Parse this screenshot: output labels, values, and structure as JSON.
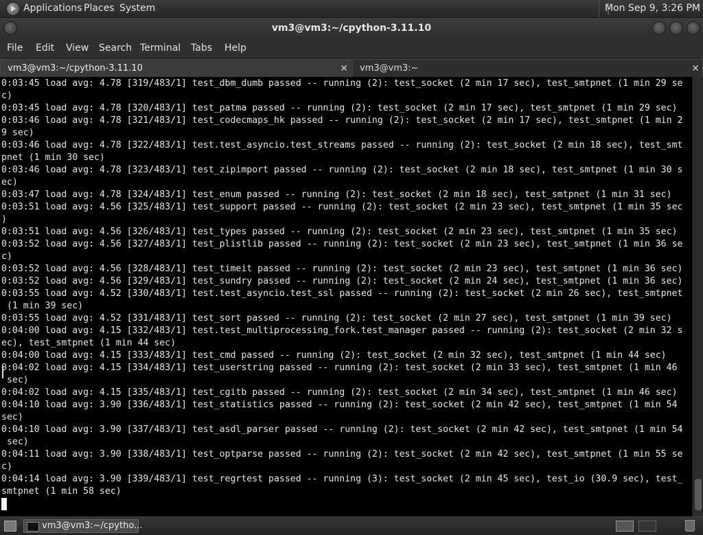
{
  "top_panel": {
    "menus": [
      "Applications",
      "Places",
      "System"
    ],
    "clock": "Mon Sep  9,  3:26 PM"
  },
  "window": {
    "title": "vm3@vm3:~/cpython-3.11.10"
  },
  "menubar": [
    "File",
    "Edit",
    "View",
    "Search",
    "Terminal",
    "Tabs",
    "Help"
  ],
  "tabs": [
    {
      "label": "vm3@vm3:~/cpython-3.11.10",
      "active": true
    },
    {
      "label": "vm3@vm3:~",
      "active": false
    }
  ],
  "terminal_lines": [
    "0:03:45 load avg: 4.78 [319/483/1] test_dbm_dumb passed -- running (2): test_socket (2 min 17 sec), test_smtpnet (1 min 29 se",
    "c)",
    "0:03:45 load avg: 4.78 [320/483/1] test_patma passed -- running (2): test_socket (2 min 17 sec), test_smtpnet (1 min 29 sec)",
    "0:03:46 load avg: 4.78 [321/483/1] test_codecmaps_hk passed -- running (2): test_socket (2 min 17 sec), test_smtpnet (1 min 2",
    "9 sec)",
    "0:03:46 load avg: 4.78 [322/483/1] test.test_asyncio.test_streams passed -- running (2): test_socket (2 min 18 sec), test_smt",
    "pnet (1 min 30 sec)",
    "0:03:46 load avg: 4.78 [323/483/1] test_zipimport passed -- running (2): test_socket (2 min 18 sec), test_smtpnet (1 min 30 s",
    "ec)",
    "0:03:47 load avg: 4.78 [324/483/1] test_enum passed -- running (2): test_socket (2 min 18 sec), test_smtpnet (1 min 31 sec)",
    "0:03:51 load avg: 4.56 [325/483/1] test_support passed -- running (2): test_socket (2 min 23 sec), test_smtpnet (1 min 35 sec",
    ")",
    "0:03:51 load avg: 4.56 [326/483/1] test_types passed -- running (2): test_socket (2 min 23 sec), test_smtpnet (1 min 35 sec)",
    "0:03:52 load avg: 4.56 [327/483/1] test_plistlib passed -- running (2): test_socket (2 min 23 sec), test_smtpnet (1 min 36 se",
    "c)",
    "0:03:52 load avg: 4.56 [328/483/1] test_timeit passed -- running (2): test_socket (2 min 23 sec), test_smtpnet (1 min 36 sec)",
    "0:03:52 load avg: 4.56 [329/483/1] test_sundry passed -- running (2): test_socket (2 min 24 sec), test_smtpnet (1 min 36 sec)",
    "0:03:55 load avg: 4.52 [330/483/1] test.test_asyncio.test_ssl passed -- running (2): test_socket (2 min 26 sec), test_smtpnet",
    " (1 min 39 sec)",
    "0:03:55 load avg: 4.52 [331/483/1] test_sort passed -- running (2): test_socket (2 min 27 sec), test_smtpnet (1 min 39 sec)",
    "0:04:00 load avg: 4.15 [332/483/1] test.test_multiprocessing_fork.test_manager passed -- running (2): test_socket (2 min 32 s",
    "ec), test_smtpnet (1 min 44 sec)",
    "0:04:00 load avg: 4.15 [333/483/1] test_cmd passed -- running (2): test_socket (2 min 32 sec), test_smtpnet (1 min 44 sec)",
    "0:04:02 load avg: 4.15 [334/483/1] test_userstring passed -- running (2): test_socket (2 min 33 sec), test_smtpnet (1 min 46",
    " sec)",
    "0:04:02 load avg: 4.15 [335/483/1] test_cgitb passed -- running (2): test_socket (2 min 34 sec), test_smtpnet (1 min 46 sec)",
    "0:04:10 load avg: 3.90 [336/483/1] test_statistics passed -- running (2): test_socket (2 min 42 sec), test_smtpnet (1 min 54",
    "sec)",
    "0:04:10 load avg: 3.90 [337/483/1] test_asdl_parser passed -- running (2): test_socket (2 min 42 sec), test_smtpnet (1 min 54",
    " sec)",
    "0:04:11 load avg: 3.90 [338/483/1] test_optparse passed -- running (2): test_socket (2 min 42 sec), test_smtpnet (1 min 55 se",
    "c)",
    "0:04:14 load avg: 3.90 [339/483/1] test_regrtest passed -- running (3): test_socket (2 min 45 sec), test_io (30.9 sec), test_",
    "smtpnet (1 min 58 sec)"
  ],
  "taskbar": {
    "task_label": "vm3@vm3:~/cpytho..."
  }
}
